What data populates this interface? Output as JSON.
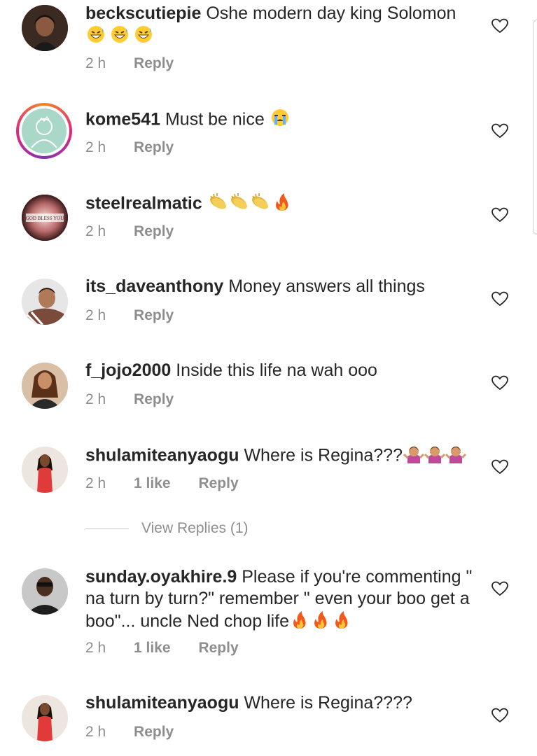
{
  "comments": [
    {
      "username": "beckscutiepie",
      "text": "Oshe modern day king Solomon",
      "emoji": "grinning-sweat-x3",
      "time": "2 h",
      "likes": "",
      "reply": "Reply"
    },
    {
      "username": "kome541",
      "text": "Must be nice",
      "emoji": "crying",
      "time": "2 h",
      "likes": "",
      "reply": "Reply"
    },
    {
      "username": "steelrealmatic",
      "text": "",
      "emoji": "clapping-x3-fire",
      "time": "2 h",
      "likes": "",
      "reply": "Reply"
    },
    {
      "username": "its_daveanthony",
      "text": "Money answers all things",
      "emoji": "",
      "time": "2 h",
      "likes": "",
      "reply": "Reply"
    },
    {
      "username": "f_jojo2000",
      "text": "Inside this life na wah ooo",
      "emoji": "",
      "time": "2 h",
      "likes": "",
      "reply": "Reply"
    },
    {
      "username": "shulamiteanyaogu",
      "text": "Where is Regina???",
      "emoji": "shrug-woman-x3",
      "time": "2 h",
      "likes": "1 like",
      "reply": "Reply"
    },
    {
      "username": "sunday.oyakhire.9",
      "text": "Please if you're commenting \" na turn by turn?\" remember \" even your boo get a boo\"... uncle Ned chop life",
      "emoji": "fire-x3",
      "time": "2 h",
      "likes": "1 like",
      "reply": "Reply"
    },
    {
      "username": "shulamiteanyaogu",
      "text": "Where is Regina????",
      "emoji": "",
      "time": "2 h",
      "likes": "",
      "reply": "Reply"
    }
  ],
  "view_replies": "View Replies (1)",
  "avatar3_text": "GOD BLESS YOU",
  "colors": {
    "text": "#262626",
    "meta": "#8e8e8e",
    "ring_start": "#f58529",
    "ring_end": "#8134af"
  }
}
